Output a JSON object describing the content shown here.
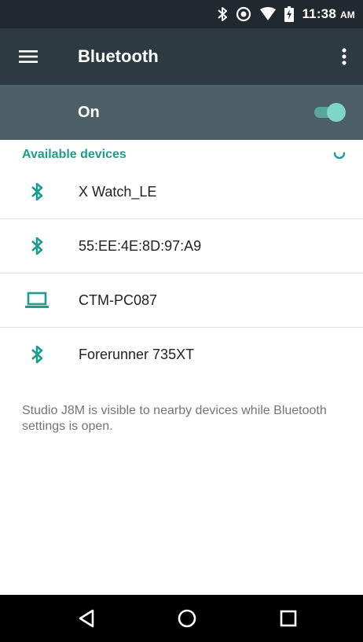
{
  "status_bar": {
    "time": "11:38",
    "ampm": "AM",
    "icons": [
      "bluetooth-icon",
      "do-not-disturb-icon",
      "wifi-icon",
      "battery-charging-icon"
    ]
  },
  "app_bar": {
    "title": "Bluetooth",
    "menu_icon": "menu-icon",
    "overflow_icon": "more-vert-icon"
  },
  "master_switch": {
    "label": "On",
    "state": "on"
  },
  "available_devices": {
    "header": "Available devices",
    "devices": [
      {
        "name": "X Watch_LE",
        "icon": "bluetooth-icon"
      },
      {
        "name": "55:EE:4E:8D:97:A9",
        "icon": "bluetooth-icon"
      },
      {
        "name": "CTM-PC087",
        "icon": "laptop-icon"
      },
      {
        "name": "Forerunner 735XT",
        "icon": "bluetooth-icon"
      }
    ]
  },
  "footer_note": "Studio J8M is visible to nearby devices while Bluetooth settings is open.",
  "nav_bar": {
    "buttons": [
      "back-icon",
      "home-icon",
      "recents-icon"
    ]
  },
  "colors": {
    "status_bar_bg": "#22292e",
    "app_bar_bg": "#2c3a41",
    "switch_bar_bg": "#4c5f66",
    "accent": "#1f9c8c",
    "toggle_thumb": "#7fd6c4"
  }
}
